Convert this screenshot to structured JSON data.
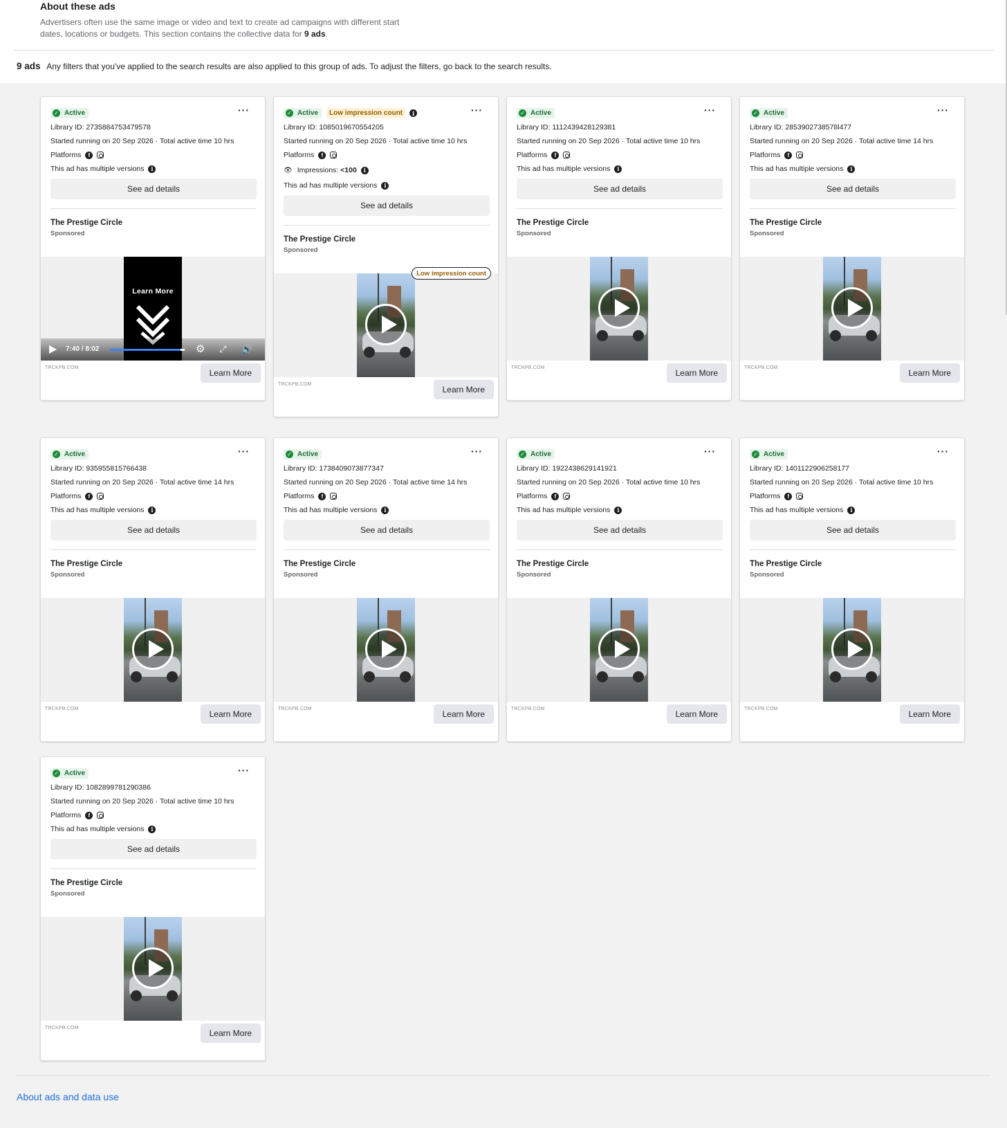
{
  "about": {
    "title": "About these ads",
    "desc_before": "Advertisers often use the same image or video and text to create ad campaigns with different start dates, locations or budgets. This section contains the collective data for ",
    "desc_bold": "9 ads",
    "desc_after": "."
  },
  "results": {
    "count": "9 ads",
    "note": "Any filters that you've applied to the search results are also applied to this group of ads. To adjust the filters, go back to the search results."
  },
  "labels": {
    "active": "Active",
    "low_impression": "Low impression count",
    "platforms": "Platforms",
    "multiple_versions": "This ad has multiple versions",
    "see_details": "See ad details",
    "advertiser": "The Prestige Circle",
    "sponsored": "Sponsored",
    "domain": "TRCKPB.COM",
    "cta": "Learn More",
    "impressions_label": "Impressions:",
    "impressions_value": "<100",
    "video_time": "7:40 / 8:02",
    "video_overlay_text": "Learn More",
    "video_progress": 0.94,
    "more": "···"
  },
  "cards": [
    {
      "library_id": "Library ID: 2735884753479578",
      "started": "Started running on 20 Sep 2026 · Total active time 10 hrs",
      "low_impression": false,
      "video_player": true
    },
    {
      "library_id": "Library ID: 1085019670554205",
      "started": "Started running on 20 Sep 2026 · Total active time 10 hrs",
      "low_impression": true,
      "video_player": false
    },
    {
      "library_id": "Library ID: 1112439428129381",
      "started": "Started running on 20 Sep 2026 · Total active time 10 hrs",
      "low_impression": false,
      "video_player": false
    },
    {
      "library_id": "Library ID: 2853902738578l477",
      "started": "Started running on 20 Sep 2026 · Total active time 14 hrs",
      "low_impression": false,
      "video_player": false
    },
    {
      "library_id": "Library ID: 935955815766438",
      "started": "Started running on 20 Sep 2026 · Total active time 14 hrs",
      "low_impression": false,
      "video_player": false
    },
    {
      "library_id": "Library ID: 1738409073877347",
      "started": "Started running on 20 Sep 2026 · Total active time 14 hrs",
      "low_impression": false,
      "video_player": false
    },
    {
      "library_id": "Library ID: 1922438629141921",
      "started": "Started running on 20 Sep 2026 · Total active time 10 hrs",
      "low_impression": false,
      "video_player": false
    },
    {
      "library_id": "Library ID: 1401122906258177",
      "started": "Started running on 20 Sep 2026 · Total active time 10 hrs",
      "low_impression": false,
      "video_player": false
    },
    {
      "library_id": "Library ID: 1082899781290386",
      "started": "Started running on 20 Sep 2026 · Total active time 10 hrs",
      "low_impression": false,
      "video_player": false
    }
  ],
  "footer": {
    "link": "About ads and data use"
  },
  "colors": {
    "active_green": "#1d8a3b",
    "low_orange": "#915d00",
    "link_blue": "#216fdb",
    "page_bg": "#f2f2f2"
  },
  "icons": [
    "check-icon",
    "info-icon",
    "more-icon",
    "facebook-icon",
    "instagram-icon",
    "eye-icon",
    "play-icon",
    "gear-icon",
    "fullscreen-icon",
    "volume-icon"
  ]
}
